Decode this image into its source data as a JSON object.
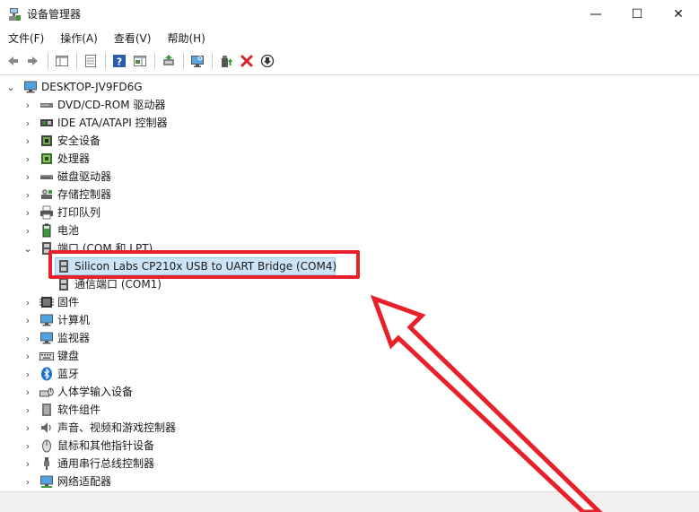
{
  "window": {
    "title": "设备管理器",
    "minimize_glyph": "—",
    "maximize_glyph": "☐",
    "close_glyph": "✕"
  },
  "menu": [
    "文件(F)",
    "操作(A)",
    "查看(V)",
    "帮助(H)"
  ],
  "toolbar": [
    "back-icon",
    "forward-icon",
    "console-tree-icon",
    "properties-icon",
    "help-icon",
    "action-pane-icon",
    "update-driver-icon",
    "scan-hardware-icon",
    "enable-device-icon",
    "uninstall-device-icon",
    "disable-device-icon"
  ],
  "tree": {
    "root": "DESKTOP-JV9FD6G",
    "categories": [
      {
        "label": "DVD/CD-ROM 驱动器",
        "icon": "dvd-drive-icon"
      },
      {
        "label": "IDE ATA/ATAPI 控制器",
        "icon": "ide-controller-icon"
      },
      {
        "label": "安全设备",
        "icon": "security-device-icon"
      },
      {
        "label": "处理器",
        "icon": "processor-icon"
      },
      {
        "label": "磁盘驱动器",
        "icon": "disk-drive-icon"
      },
      {
        "label": "存储控制器",
        "icon": "storage-controller-icon"
      },
      {
        "label": "打印队列",
        "icon": "printer-icon"
      },
      {
        "label": "电池",
        "icon": "battery-icon"
      },
      {
        "label": "端口 (COM 和 LPT)",
        "icon": "port-icon",
        "expanded": true,
        "children": [
          {
            "label": "Silicon Labs CP210x USB to UART Bridge (COM4)",
            "icon": "port-device-icon",
            "selected": true
          },
          {
            "label": "通信端口 (COM1)",
            "icon": "port-device-icon"
          }
        ]
      },
      {
        "label": "固件",
        "icon": "firmware-icon"
      },
      {
        "label": "计算机",
        "icon": "computer-icon"
      },
      {
        "label": "监视器",
        "icon": "monitor-icon"
      },
      {
        "label": "键盘",
        "icon": "keyboard-icon"
      },
      {
        "label": "蓝牙",
        "icon": "bluetooth-icon"
      },
      {
        "label": "人体学输入设备",
        "icon": "hid-icon"
      },
      {
        "label": "软件组件",
        "icon": "software-component-icon"
      },
      {
        "label": "声音、视频和游戏控制器",
        "icon": "sound-icon"
      },
      {
        "label": "鼠标和其他指针设备",
        "icon": "mouse-icon"
      },
      {
        "label": "通用串行总线控制器",
        "icon": "usb-icon"
      },
      {
        "label": "网络适配器",
        "icon": "network-adapter-icon"
      }
    ]
  },
  "colors": {
    "highlight_red": "#e8202a",
    "selection_bg": "#cce4f7",
    "selection_border": "#99c9ef"
  }
}
